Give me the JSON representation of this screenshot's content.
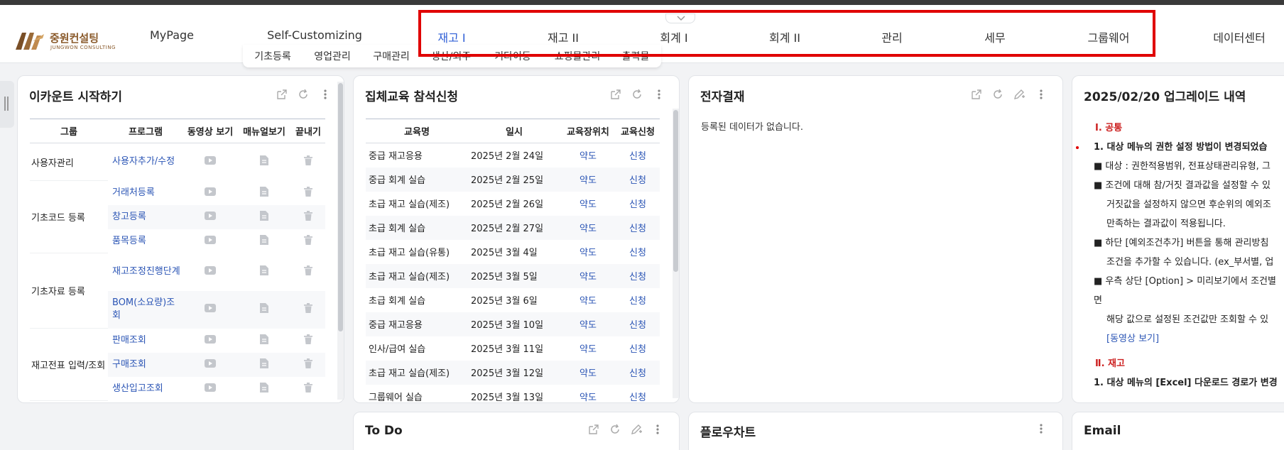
{
  "logo": {
    "name": "중원컨설팅",
    "sub": "JUNGWON CONSULTING",
    "color": "#8a5a2b"
  },
  "nav": {
    "items": [
      {
        "label": "MyPage",
        "active": false
      },
      {
        "label": "Self-Customizing",
        "active": false
      },
      {
        "label": "재고 I",
        "active": true
      },
      {
        "label": "재고 II",
        "active": false
      },
      {
        "label": "회계 I",
        "active": false
      },
      {
        "label": "회계 II",
        "active": false
      },
      {
        "label": "관리",
        "active": false
      },
      {
        "label": "세무",
        "active": false
      },
      {
        "label": "그룹웨어",
        "active": false
      },
      {
        "label": "데이터센터",
        "active": false
      }
    ],
    "sub_items": [
      "기초등록",
      "영업관리",
      "구매관리",
      "생산/외주",
      "기타이동",
      "쇼핑몰관리",
      "출력물"
    ],
    "active_color": "#2f5fd6",
    "highlight_color": "#e00000"
  },
  "account_panel": {
    "title": "이카운트 시작하기",
    "headers": [
      "그룹",
      "프로그램",
      "동영상 보기",
      "매뉴얼보기",
      "끝내기"
    ],
    "groups": [
      {
        "name": "사용자관리",
        "programs": [
          "사용자추가/수정"
        ]
      },
      {
        "name": "기초코드 등록",
        "programs": [
          "거래처등록",
          "창고등록",
          "품목등록"
        ]
      },
      {
        "name": "기초자료 등록",
        "programs": [
          "재고조정진행단계",
          "BOM(소요량)조회"
        ]
      },
      {
        "name": "재고전표 입력/조회",
        "programs": [
          "판매조회",
          "구매조회",
          "생산입고조회"
        ]
      }
    ]
  },
  "education_panel": {
    "title": "집체교육 참석신청",
    "headers": [
      "교육명",
      "일시",
      "교육장위치",
      "교육신청"
    ],
    "rows": [
      {
        "name": "중급 재고응용",
        "date": "2025년 2월 24일",
        "location": "약도",
        "apply": "신청"
      },
      {
        "name": "중급 회계 실습",
        "date": "2025년 2월 25일",
        "location": "약도",
        "apply": "신청"
      },
      {
        "name": "초급 재고 실습(제조)",
        "date": "2025년 2월 26일",
        "location": "약도",
        "apply": "신청"
      },
      {
        "name": "초급 회계 실습",
        "date": "2025년 2월 27일",
        "location": "약도",
        "apply": "신청"
      },
      {
        "name": "초급 재고 실습(유통)",
        "date": "2025년 3월 4일",
        "location": "약도",
        "apply": "신청"
      },
      {
        "name": "초급 재고 실습(제조)",
        "date": "2025년 3월 5일",
        "location": "약도",
        "apply": "신청"
      },
      {
        "name": "초급 회계 실습",
        "date": "2025년 3월 6일",
        "location": "약도",
        "apply": "신청"
      },
      {
        "name": "중급 재고응용",
        "date": "2025년 3월 10일",
        "location": "약도",
        "apply": "신청"
      },
      {
        "name": "인사/급여 실습",
        "date": "2025년 3월 11일",
        "location": "약도",
        "apply": "신청"
      },
      {
        "name": "초급 재고 실습(제조)",
        "date": "2025년 3월 12일",
        "location": "약도",
        "apply": "신청"
      },
      {
        "name": "그룹웨어 실습",
        "date": "2025년 3월 13일",
        "location": "약도",
        "apply": "신청"
      }
    ]
  },
  "approval_panel": {
    "title": "전자결재",
    "empty_text": "등록된 데이터가 없습니다."
  },
  "upgrade_panel": {
    "title": "2025/02/20 업그레이드 내역",
    "section1": "Ⅰ. 공통",
    "item1": "1. 대상 메뉴의 권한 설정 방법이 변경되었습",
    "bullet1": "■ 대상 : 권한적용범위, 전표상태관리유형, 그",
    "bullet2": "■ 조건에 대해 참/거짓 결과값을 설정할 수 있",
    "bullet2_l2": "거짓값을 설정하지 않으면 후순위의 예외조",
    "bullet2_l3": "만족하는 결과값이 적용됩니다.",
    "bullet3": "■ 하단 [예외조건추가] 버튼을 통해 관리방침",
    "bullet3_l2": "조건을 추가할 수 있습니다. (ex_부서별, 업",
    "bullet4": "■ 우측 상단 [Option] > 미리보기에서 조건별",
    "bullet4_l2": "면",
    "bullet4_l3": "해당 값으로 설정된 조건값만 조회할 수 있",
    "video_link": "[동영상 보기]",
    "section2": "Ⅱ. 재고",
    "item2": "1. 대상 메뉴의 [Excel] 다운로드 경로가 변경",
    "section_color": "#cc1f1f"
  },
  "todo_panel": {
    "title": "To Do"
  },
  "flowchart_panel": {
    "title": "플로우차트"
  },
  "email_panel": {
    "title": "Email"
  }
}
